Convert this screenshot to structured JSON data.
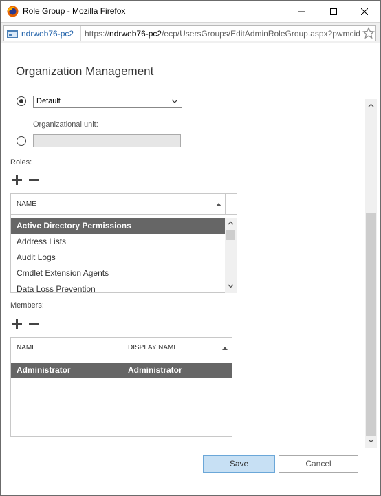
{
  "window": {
    "title": "Role Group - Mozilla Firefox"
  },
  "urlbar": {
    "site": "ndrweb76-pc2",
    "url_prefix": "https://",
    "url_host": "ndrweb76-pc2",
    "url_path": "/ecp/UsersGroups/EditAdminRoleGroup.aspx?pwmcid"
  },
  "page": {
    "title": "Organization Management"
  },
  "scope": {
    "dropdown_value": "Default",
    "ou_label": "Organizational unit:",
    "ou_value": ""
  },
  "roles": {
    "label": "Roles:",
    "header_name": "NAME",
    "items": [
      "Active Directory Permissions",
      "Address Lists",
      "Audit Logs",
      "Cmdlet Extension Agents",
      "Data Loss Prevention"
    ]
  },
  "members": {
    "label": "Members:",
    "header_name": "NAME",
    "header_display": "DISPLAY NAME",
    "rows": [
      {
        "name": "Administrator",
        "display": "Administrator"
      }
    ]
  },
  "buttons": {
    "save": "Save",
    "cancel": "Cancel"
  },
  "colors": {
    "selected_row": "#666666",
    "save_bg": "#c7e0f4"
  }
}
